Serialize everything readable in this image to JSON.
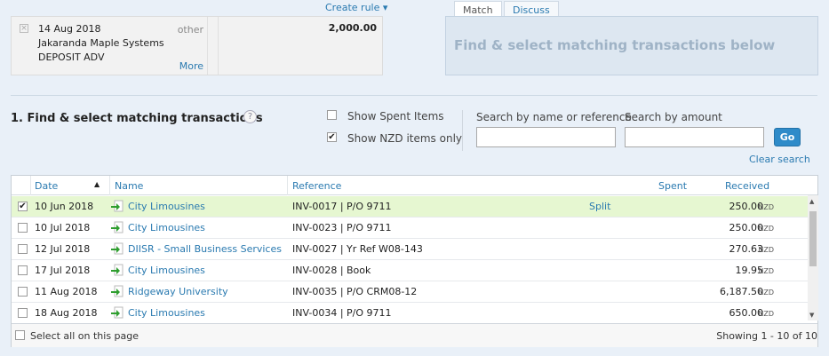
{
  "statement": {
    "date": "14 Aug 2018",
    "payee": "Jakaranda Maple Systems",
    "reference": "DEPOSIT ADV",
    "type": "other",
    "more_link": "More",
    "amount": "2,000.00"
  },
  "create_rule_label": "Create rule ▾",
  "tabs": [
    {
      "label": "Match"
    },
    {
      "label": "Discuss"
    }
  ],
  "match_panel_message": "Find & select matching transactions below",
  "search": {
    "title": "1. Find & select matching transactions",
    "help_icon": "?",
    "show_spent_label": "Show Spent Items",
    "show_nzd_label": "Show NZD items only",
    "search_name_label": "Search by name or reference",
    "search_amount_label": "Search by amount",
    "go_label": "Go",
    "clear_label": "Clear search"
  },
  "table": {
    "columns": {
      "date": "Date",
      "name": "Name",
      "reference": "Reference",
      "spent": "Spent",
      "received": "Received"
    },
    "rows": [
      {
        "date": "10 Jun 2018",
        "name": "City Limousines",
        "reference": "INV-0017 | P/O 9711",
        "split": "Split",
        "received": "250.00",
        "currency": "NZD",
        "checked": true
      },
      {
        "date": "10 Jul 2018",
        "name": "City Limousines",
        "reference": "INV-0023 | P/O 9711",
        "split": "",
        "received": "250.00",
        "currency": "NZD",
        "checked": false
      },
      {
        "date": "12 Jul 2018",
        "name": "DIISR - Small Business Services",
        "reference": "INV-0027 | Yr Ref W08-143",
        "split": "",
        "received": "270.63",
        "currency": "NZD",
        "checked": false
      },
      {
        "date": "17 Jul 2018",
        "name": "City Limousines",
        "reference": "INV-0028 | Book",
        "split": "",
        "received": "19.95",
        "currency": "NZD",
        "checked": false
      },
      {
        "date": "11 Aug 2018",
        "name": "Ridgeway University",
        "reference": "INV-0035 | P/O CRM08-12",
        "split": "",
        "received": "6,187.50",
        "currency": "NZD",
        "checked": false
      },
      {
        "date": "18 Aug 2018",
        "name": "City Limousines",
        "reference": "INV-0034 | P/O 9711",
        "split": "",
        "received": "650.00",
        "currency": "NZD",
        "checked": false
      }
    ],
    "select_all_label": "Select all on this page",
    "showing_label": "Showing 1 - 10 of 10"
  }
}
